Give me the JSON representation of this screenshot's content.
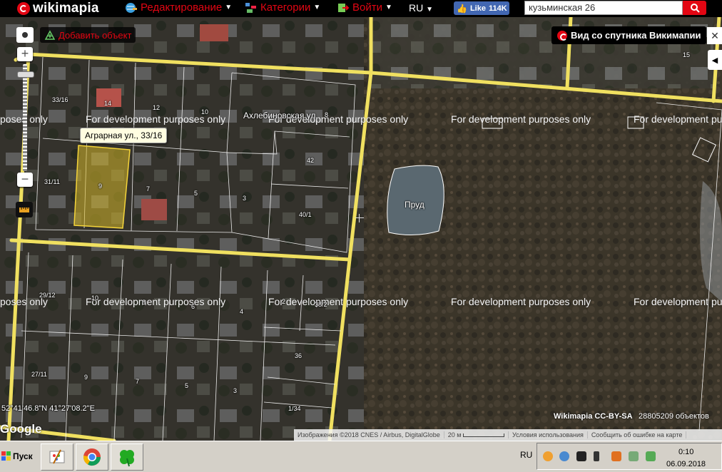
{
  "topbar": {
    "logo": "wikimapia",
    "menu_edit": "Редактирование",
    "menu_categories": "Категории",
    "menu_login": "Войти",
    "lang": "RU",
    "like_label": "Like",
    "like_count": "114K",
    "search_value": "кузьминская 26"
  },
  "map": {
    "add_object": "Добавить объект",
    "satellite_view": "Вид со спутника Викимапии",
    "tooltip": "Аграрная ул., 33/16",
    "street_label": "Ахлебиновская ул.",
    "pond_label": "Пруд",
    "watermark": "For development purposes only",
    "watermark_left": "poses only",
    "watermark_right": "For development pu",
    "coordinates": "52°41'46.8\"N 41°27'08.2\"E",
    "google": "Google",
    "attribution": "Wikimapia CC-BY-SA",
    "object_count": "28805209 объектов",
    "footer_imagery": "Изображения ©2018 CNES / Airbus, DigitalGlobe",
    "footer_scale": "20 м",
    "footer_terms": "Условия использования",
    "footer_report": "Сообщить об ошибке на карте",
    "house_numbers": {
      "n33_16": "33/16",
      "n14": "14",
      "n12": "12",
      "n10a": "10",
      "n8a": "8",
      "n31_11": "31/11",
      "n9a": "9",
      "n7a": "7",
      "n5a": "5",
      "n3a": "3",
      "n42": "42",
      "n40_1": "40/1",
      "n29_12": "29/12",
      "n10b": "10",
      "n8b": "8",
      "n6b": "6",
      "n4b": "4",
      "n2b": "2",
      "n38_2": "38/2",
      "n36": "36",
      "n27_11": "27/11",
      "n9c": "9",
      "n7c": "7",
      "n5c": "5",
      "n3c": "3",
      "n1_34": "1/34",
      "n15": "15"
    }
  },
  "taskbar": {
    "start": "Пуск",
    "lang": "RU",
    "time": "0:10",
    "date": "06.09.2018"
  },
  "colors": {
    "road": "#f0e060",
    "brand_red": "#e30613",
    "facebook": "#4267b2"
  }
}
